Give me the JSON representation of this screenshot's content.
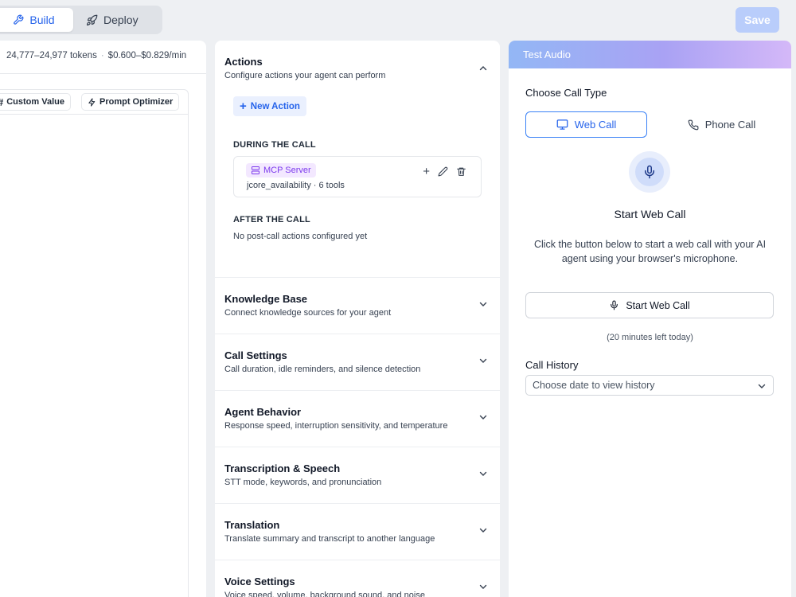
{
  "topbar": {
    "build_label": "Build",
    "deploy_label": "Deploy",
    "save_label": "Save"
  },
  "left": {
    "tokens": "24,777–24,977 tokens",
    "price": "$0.600–$0.829/min",
    "custom_value_label": "Custom Value",
    "prompt_optimizer_label": "Prompt Optimizer"
  },
  "actions": {
    "title": "Actions",
    "subtitle": "Configure actions your agent can perform",
    "new_action_label": "New Action",
    "during_label": "DURING THE CALL",
    "mcp_badge": "MCP Server",
    "mcp_detail": "jcore_availability · 6 tools",
    "after_label": "AFTER THE CALL",
    "no_post": "No post-call actions configured yet"
  },
  "sections": [
    {
      "title": "Knowledge Base",
      "subtitle": "Connect knowledge sources for your agent"
    },
    {
      "title": "Call Settings",
      "subtitle": "Call duration, idle reminders, and silence detection"
    },
    {
      "title": "Agent Behavior",
      "subtitle": "Response speed, interruption sensitivity, and temperature"
    },
    {
      "title": "Transcription & Speech",
      "subtitle": "STT mode, keywords, and pronunciation"
    },
    {
      "title": "Translation",
      "subtitle": "Translate summary and transcript to another language"
    },
    {
      "title": "Voice Settings",
      "subtitle": "Voice speed, volume, background sound, and noise"
    }
  ],
  "test_audio": {
    "header": "Test Audio",
    "choose_label": "Choose Call Type",
    "web_call": "Web Call",
    "phone_call": "Phone Call",
    "start_title": "Start Web Call",
    "start_desc": "Click the button below to start a web call with your AI agent using your browser's microphone.",
    "start_button": "Start Web Call",
    "minutes_left": "(20 minutes left today)",
    "history_label": "Call History",
    "history_placeholder": "Choose date to view history"
  },
  "colors": {
    "accent": "#2563eb",
    "save_disabled": "#b9cdfb",
    "mcp_badge_bg": "#f3e8ff",
    "mcp_badge_text": "#7c3aed"
  }
}
